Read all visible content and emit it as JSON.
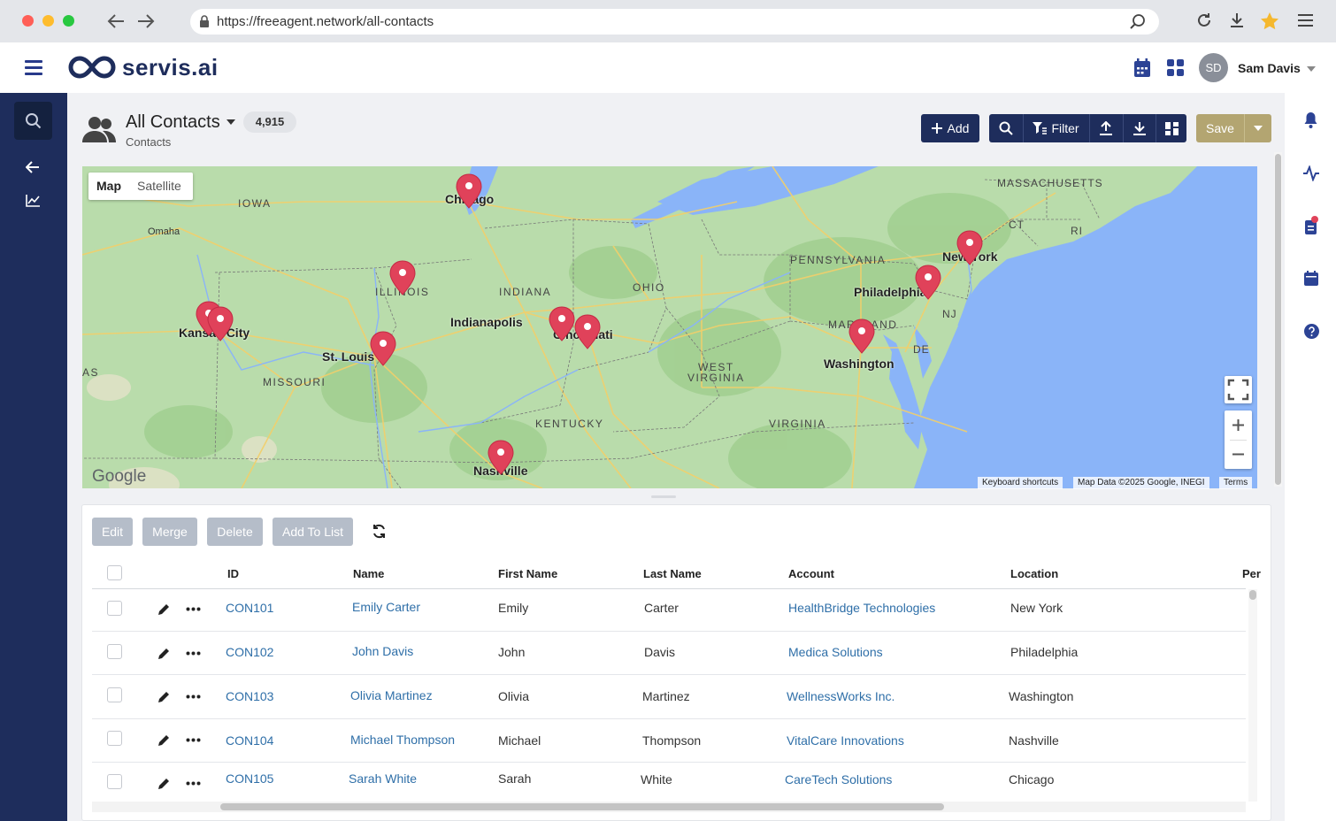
{
  "browser": {
    "url": "https://freeagent.network/all-contacts"
  },
  "app": {
    "logo_text": "servis.ai",
    "user_initials": "SD",
    "user_name": "Sam Davis"
  },
  "page": {
    "title": "All Contacts",
    "count": "4,915",
    "subtitle": "Contacts"
  },
  "toolbar": {
    "add_label": "Add",
    "filter_label": "Filter",
    "save_label": "Save"
  },
  "map": {
    "type_map": "Map",
    "type_satellite": "Satellite",
    "attribution_shortcuts": "Keyboard shortcuts",
    "attribution_data": "Map Data ©2025 Google, INEGI",
    "attribution_terms": "Terms",
    "google_logo": "Google",
    "labels": {
      "iowa": "IOWA",
      "omaha": "Omaha",
      "chicago": "Chicago",
      "illinois": "ILLINOIS",
      "indiana": "INDIANA",
      "ohio": "OHIO",
      "indianapolis": "Indianapolis",
      "kansas_city": "Kansas City",
      "st_louis": "St. Louis",
      "missouri": "MISSOURI",
      "as": "AS",
      "cincinnati": "Cincinnati",
      "kentucky": "KENTUCKY",
      "nashville": "Nashville",
      "west_virginia_1": "WEST",
      "west_virginia_2": "VIRGINIA",
      "virginia": "VIRGINIA",
      "pennsylvania": "PENNSYLVANIA",
      "philadelphia": "Philadelphia",
      "new_york": "New York",
      "maryland": "MARYLAND",
      "washington": "Washington",
      "de": "DE",
      "nj": "NJ",
      "ct": "CT",
      "ri": "RI",
      "massachusetts": "MASSACHUSETTS"
    }
  },
  "actions": {
    "edit": "Edit",
    "merge": "Merge",
    "delete": "Delete",
    "add_to_list": "Add To List"
  },
  "table": {
    "columns": [
      "ID",
      "Name",
      "First Name",
      "Last Name",
      "Account",
      "Location",
      "Per"
    ],
    "rows": [
      {
        "id": "CON101",
        "name": "Emily Carter",
        "first": "Emily",
        "last": "Carter",
        "account": "HealthBridge Technologies",
        "location": "New York"
      },
      {
        "id": "CON102",
        "name": "John Davis",
        "first": "John",
        "last": "Davis",
        "account": "Medica Solutions",
        "location": "Philadelphia"
      },
      {
        "id": "CON103",
        "name": "Olivia Martinez",
        "first": "Olivia",
        "last": "Martinez",
        "account": "WellnessWorks Inc.",
        "location": "Washington"
      },
      {
        "id": "CON104",
        "name": "Michael Thompson",
        "first": "Michael",
        "last": "Thompson",
        "account": "VitalCare Innovations",
        "location": "Nashville"
      },
      {
        "id": "CON105",
        "name": "Sarah White",
        "first": "Sarah",
        "last": "White",
        "account": "CareTech Solutions",
        "location": "Chicago"
      }
    ]
  },
  "colors": {
    "navy": "#1e2d5c",
    "save_gold": "#b3a571",
    "link_blue": "#2f6fa8",
    "pin_red": "#e0425a",
    "water": "#8ab4f8",
    "land": "#b9dcab"
  }
}
